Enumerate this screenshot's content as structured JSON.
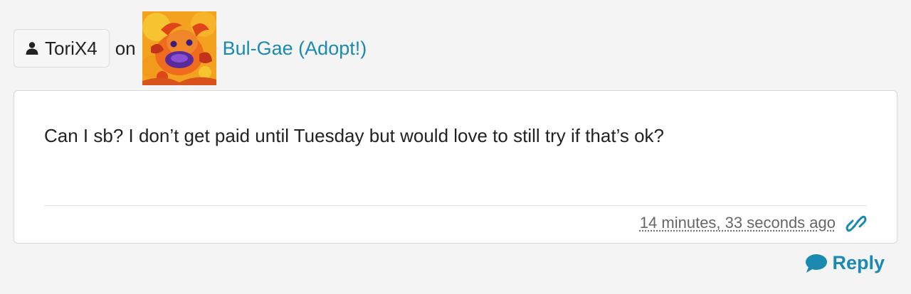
{
  "comment": {
    "author": "ToriX4",
    "on_word": "on",
    "artwork_title": "Bul-Gae (Adopt!)",
    "body": "Can I sb? I don’t get paid until Tuesday but would love to still try if that’s ok?",
    "timestamp": "14 minutes, 33 seconds ago"
  },
  "actions": {
    "reply_label": "Reply"
  },
  "icons": {
    "user": "user-icon",
    "permalink": "link-icon",
    "reply": "chat-bubble-icon"
  },
  "colors": {
    "accent": "#1a8ab0",
    "background": "#f4f4f5",
    "card": "#ffffff"
  }
}
